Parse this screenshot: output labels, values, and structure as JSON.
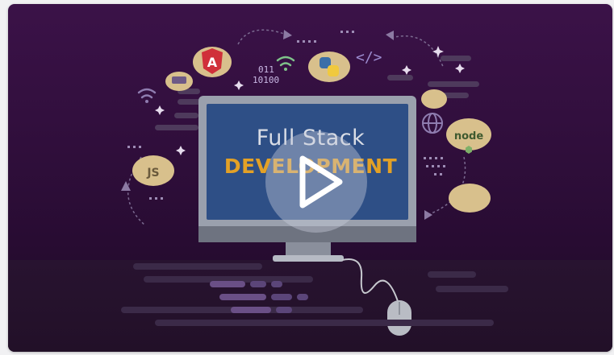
{
  "video": {
    "title_line1": "Full Stack",
    "title_line2": "DEVELOPMENT",
    "play_icon": "play-icon"
  },
  "scene_text": {
    "code_binary_top": "011",
    "code_binary_bottom": "10100",
    "html_tag": "</>",
    "angular_letter": "A",
    "js_label": "JS",
    "node_label": "node"
  },
  "colors": {
    "background_top": "#3b1248",
    "background_bottom": "#1e0a26",
    "screen_blue": "#2e4f86",
    "accent_orange": "#e3a126",
    "angular_red": "#d0303a",
    "cloud_tan": "#d8c08c"
  }
}
